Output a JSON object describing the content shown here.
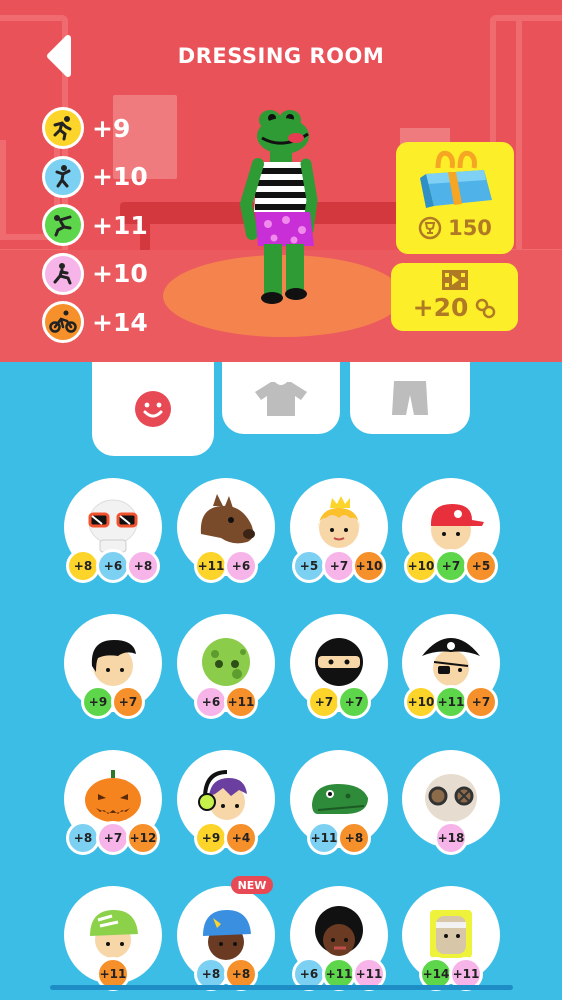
{
  "header": {
    "title": "DRESSING ROOM",
    "back_icon": "back-arrow-icon",
    "background_color": "#e95258"
  },
  "stats": [
    {
      "icon": "running-icon",
      "color": "#fcd42a",
      "value": "+9"
    },
    {
      "icon": "jumping-icon",
      "color": "#7cd0f2",
      "value": "+10"
    },
    {
      "icon": "climbing-icon",
      "color": "#5ed64b",
      "value": "+11"
    },
    {
      "icon": "sliding-icon",
      "color": "#f6b4e8",
      "value": "+10"
    },
    {
      "icon": "cycling-icon",
      "color": "#f6902b",
      "value": "+14"
    }
  ],
  "shop": {
    "chest_icon": "gift-chest-icon",
    "chest_price": "150",
    "chest_currency_icon": "trophy-coin-icon",
    "video_icon": "film-strip-icon",
    "video_reward": "+20",
    "video_reward_icon": "coins-icon"
  },
  "tabs": [
    {
      "name": "face",
      "icon": "face-icon",
      "active": true
    },
    {
      "name": "shirt",
      "icon": "shirt-icon",
      "active": false
    },
    {
      "name": "pants",
      "icon": "pants-icon",
      "active": false
    }
  ],
  "badge_colors": {
    "yellow": "#fcd42a",
    "blue": "#7cd0f2",
    "pink": "#f6b4e8",
    "orange": "#f6902b",
    "green": "#5ed64b"
  },
  "items": [
    {
      "name": "skull-sunglasses",
      "badges": [
        [
          "+8",
          "yellow"
        ],
        [
          "+6",
          "blue"
        ],
        [
          "+8",
          "pink"
        ]
      ]
    },
    {
      "name": "horse-head",
      "badges": [
        [
          "+11",
          "yellow"
        ],
        [
          "+6",
          "pink"
        ]
      ]
    },
    {
      "name": "princess-crown",
      "badges": [
        [
          "+5",
          "blue"
        ],
        [
          "+7",
          "pink"
        ],
        [
          "+10",
          "orange"
        ]
      ]
    },
    {
      "name": "red-cap",
      "badges": [
        [
          "+10",
          "yellow"
        ],
        [
          "+7",
          "green"
        ],
        [
          "+5",
          "orange"
        ]
      ]
    },
    {
      "name": "black-hair",
      "badges": [
        [
          "+9",
          "green"
        ],
        [
          "+7",
          "orange"
        ]
      ]
    },
    {
      "name": "zombie-head",
      "badges": [
        [
          "+6",
          "pink"
        ],
        [
          "+11",
          "orange"
        ]
      ]
    },
    {
      "name": "ninja-mask",
      "badges": [
        [
          "+7",
          "yellow"
        ],
        [
          "+7",
          "green"
        ]
      ]
    },
    {
      "name": "pirate-hat",
      "badges": [
        [
          "+10",
          "yellow"
        ],
        [
          "+11",
          "green"
        ],
        [
          "+7",
          "orange"
        ]
      ]
    },
    {
      "name": "pumpkin-head",
      "badges": [
        [
          "+8",
          "blue"
        ],
        [
          "+7",
          "pink"
        ],
        [
          "+12",
          "orange"
        ]
      ]
    },
    {
      "name": "headphones",
      "badges": [
        [
          "+9",
          "yellow"
        ],
        [
          "+4",
          "orange"
        ]
      ]
    },
    {
      "name": "crocodile-head",
      "badges": [
        [
          "+11",
          "blue"
        ],
        [
          "+8",
          "orange"
        ]
      ]
    },
    {
      "name": "gas-mask",
      "badges": [
        [
          "+18",
          "pink"
        ]
      ]
    },
    {
      "name": "green-helmet",
      "badges": [
        [
          "+11",
          "orange"
        ]
      ]
    },
    {
      "name": "blue-helmet",
      "new_label": "NEW",
      "badges": [
        [
          "+8",
          "blue"
        ],
        [
          "+8",
          "orange"
        ]
      ]
    },
    {
      "name": "afro-hair",
      "badges": [
        [
          "+6",
          "blue"
        ],
        [
          "+11",
          "green"
        ],
        [
          "+11",
          "pink"
        ]
      ]
    },
    {
      "name": "bandage-head",
      "badges": [
        [
          "+14",
          "green"
        ],
        [
          "+11",
          "pink"
        ]
      ]
    }
  ]
}
